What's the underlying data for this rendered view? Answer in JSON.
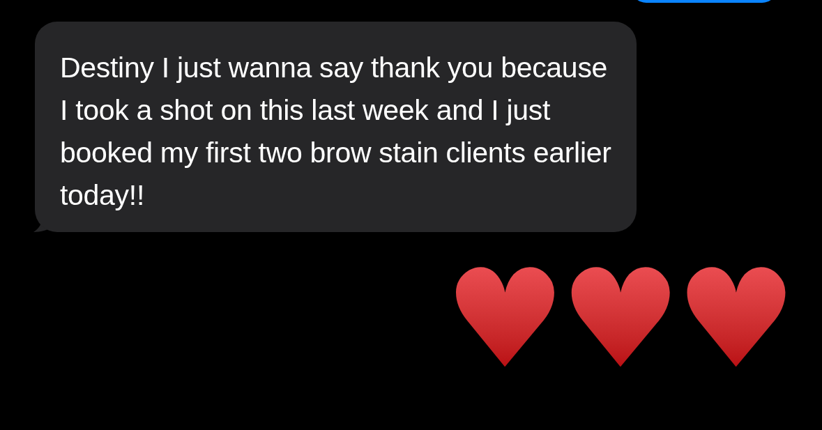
{
  "messages": [
    {
      "kind": "received",
      "text": "Destiny I just wanna say thank you because I took a shot on this last week and I just booked my first two brow stain clients earlier today!!"
    },
    {
      "kind": "emoji",
      "text": "♥♥♥"
    }
  ]
}
